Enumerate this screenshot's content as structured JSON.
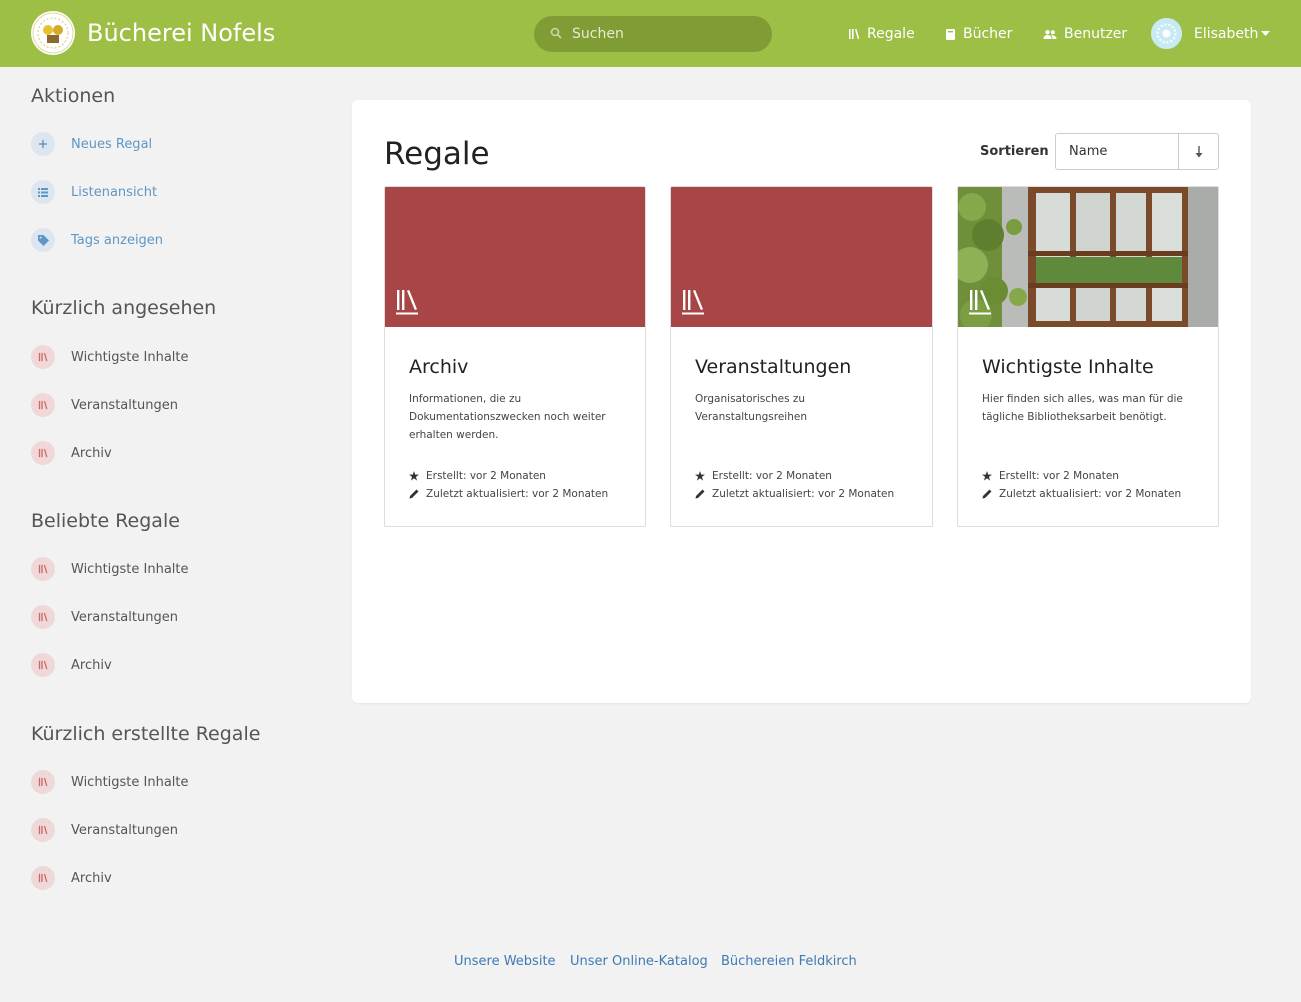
{
  "header": {
    "brand": "Bücherei Nofels",
    "search_placeholder": "Suchen",
    "nav": {
      "regale": "Regale",
      "buecher": "Bücher",
      "benutzer": "Benutzer"
    },
    "user": "Elisabeth"
  },
  "sidebar": {
    "actions_title": "Aktionen",
    "actions": [
      {
        "label": "Neues Regal",
        "icon": "plus-icon"
      },
      {
        "label": "Listenansicht",
        "icon": "list-icon"
      },
      {
        "label": "Tags anzeigen",
        "icon": "tag-icon"
      }
    ],
    "recent_title": "Kürzlich angesehen",
    "recent": [
      "Wichtigste Inhalte",
      "Veranstaltungen",
      "Archiv"
    ],
    "popular_title": "Beliebte Regale",
    "popular": [
      "Wichtigste Inhalte",
      "Veranstaltungen",
      "Archiv"
    ],
    "created_title": "Kürzlich erstellte Regale",
    "created": [
      "Wichtigste Inhalte",
      "Veranstaltungen",
      "Archiv"
    ]
  },
  "main": {
    "title": "Regale",
    "sort_label": "Sortieren",
    "sort_value": "Name",
    "shelves": [
      {
        "title": "Archiv",
        "description": "Informationen, die zu Dokumentationszwecken noch weiter erhalten werden.",
        "created": "Erstellt: vor 2 Monaten",
        "updated": "Zuletzt aktualisiert: vor 2 Monaten"
      },
      {
        "title": "Veranstaltungen",
        "description": "Organisatorisches zu Veranstaltungsreihen",
        "created": "Erstellt: vor 2 Monaten",
        "updated": "Zuletzt aktualisiert: vor 2 Monaten"
      },
      {
        "title": "Wichtigste Inhalte",
        "description": "Hier finden sich alles, was man für die tägliche Bibliotheksarbeit benötigt.",
        "created": "Erstellt: vor 2 Monaten",
        "updated": "Zuletzt aktualisiert: vor 2 Monaten"
      }
    ]
  },
  "footer": {
    "links": [
      "Unsere Website",
      "Unser Online-Katalog",
      "Büchereien Feldkirch"
    ]
  },
  "colors": {
    "header": "#9dbf45",
    "cover": "#a84547",
    "link": "#3d7ab4"
  }
}
